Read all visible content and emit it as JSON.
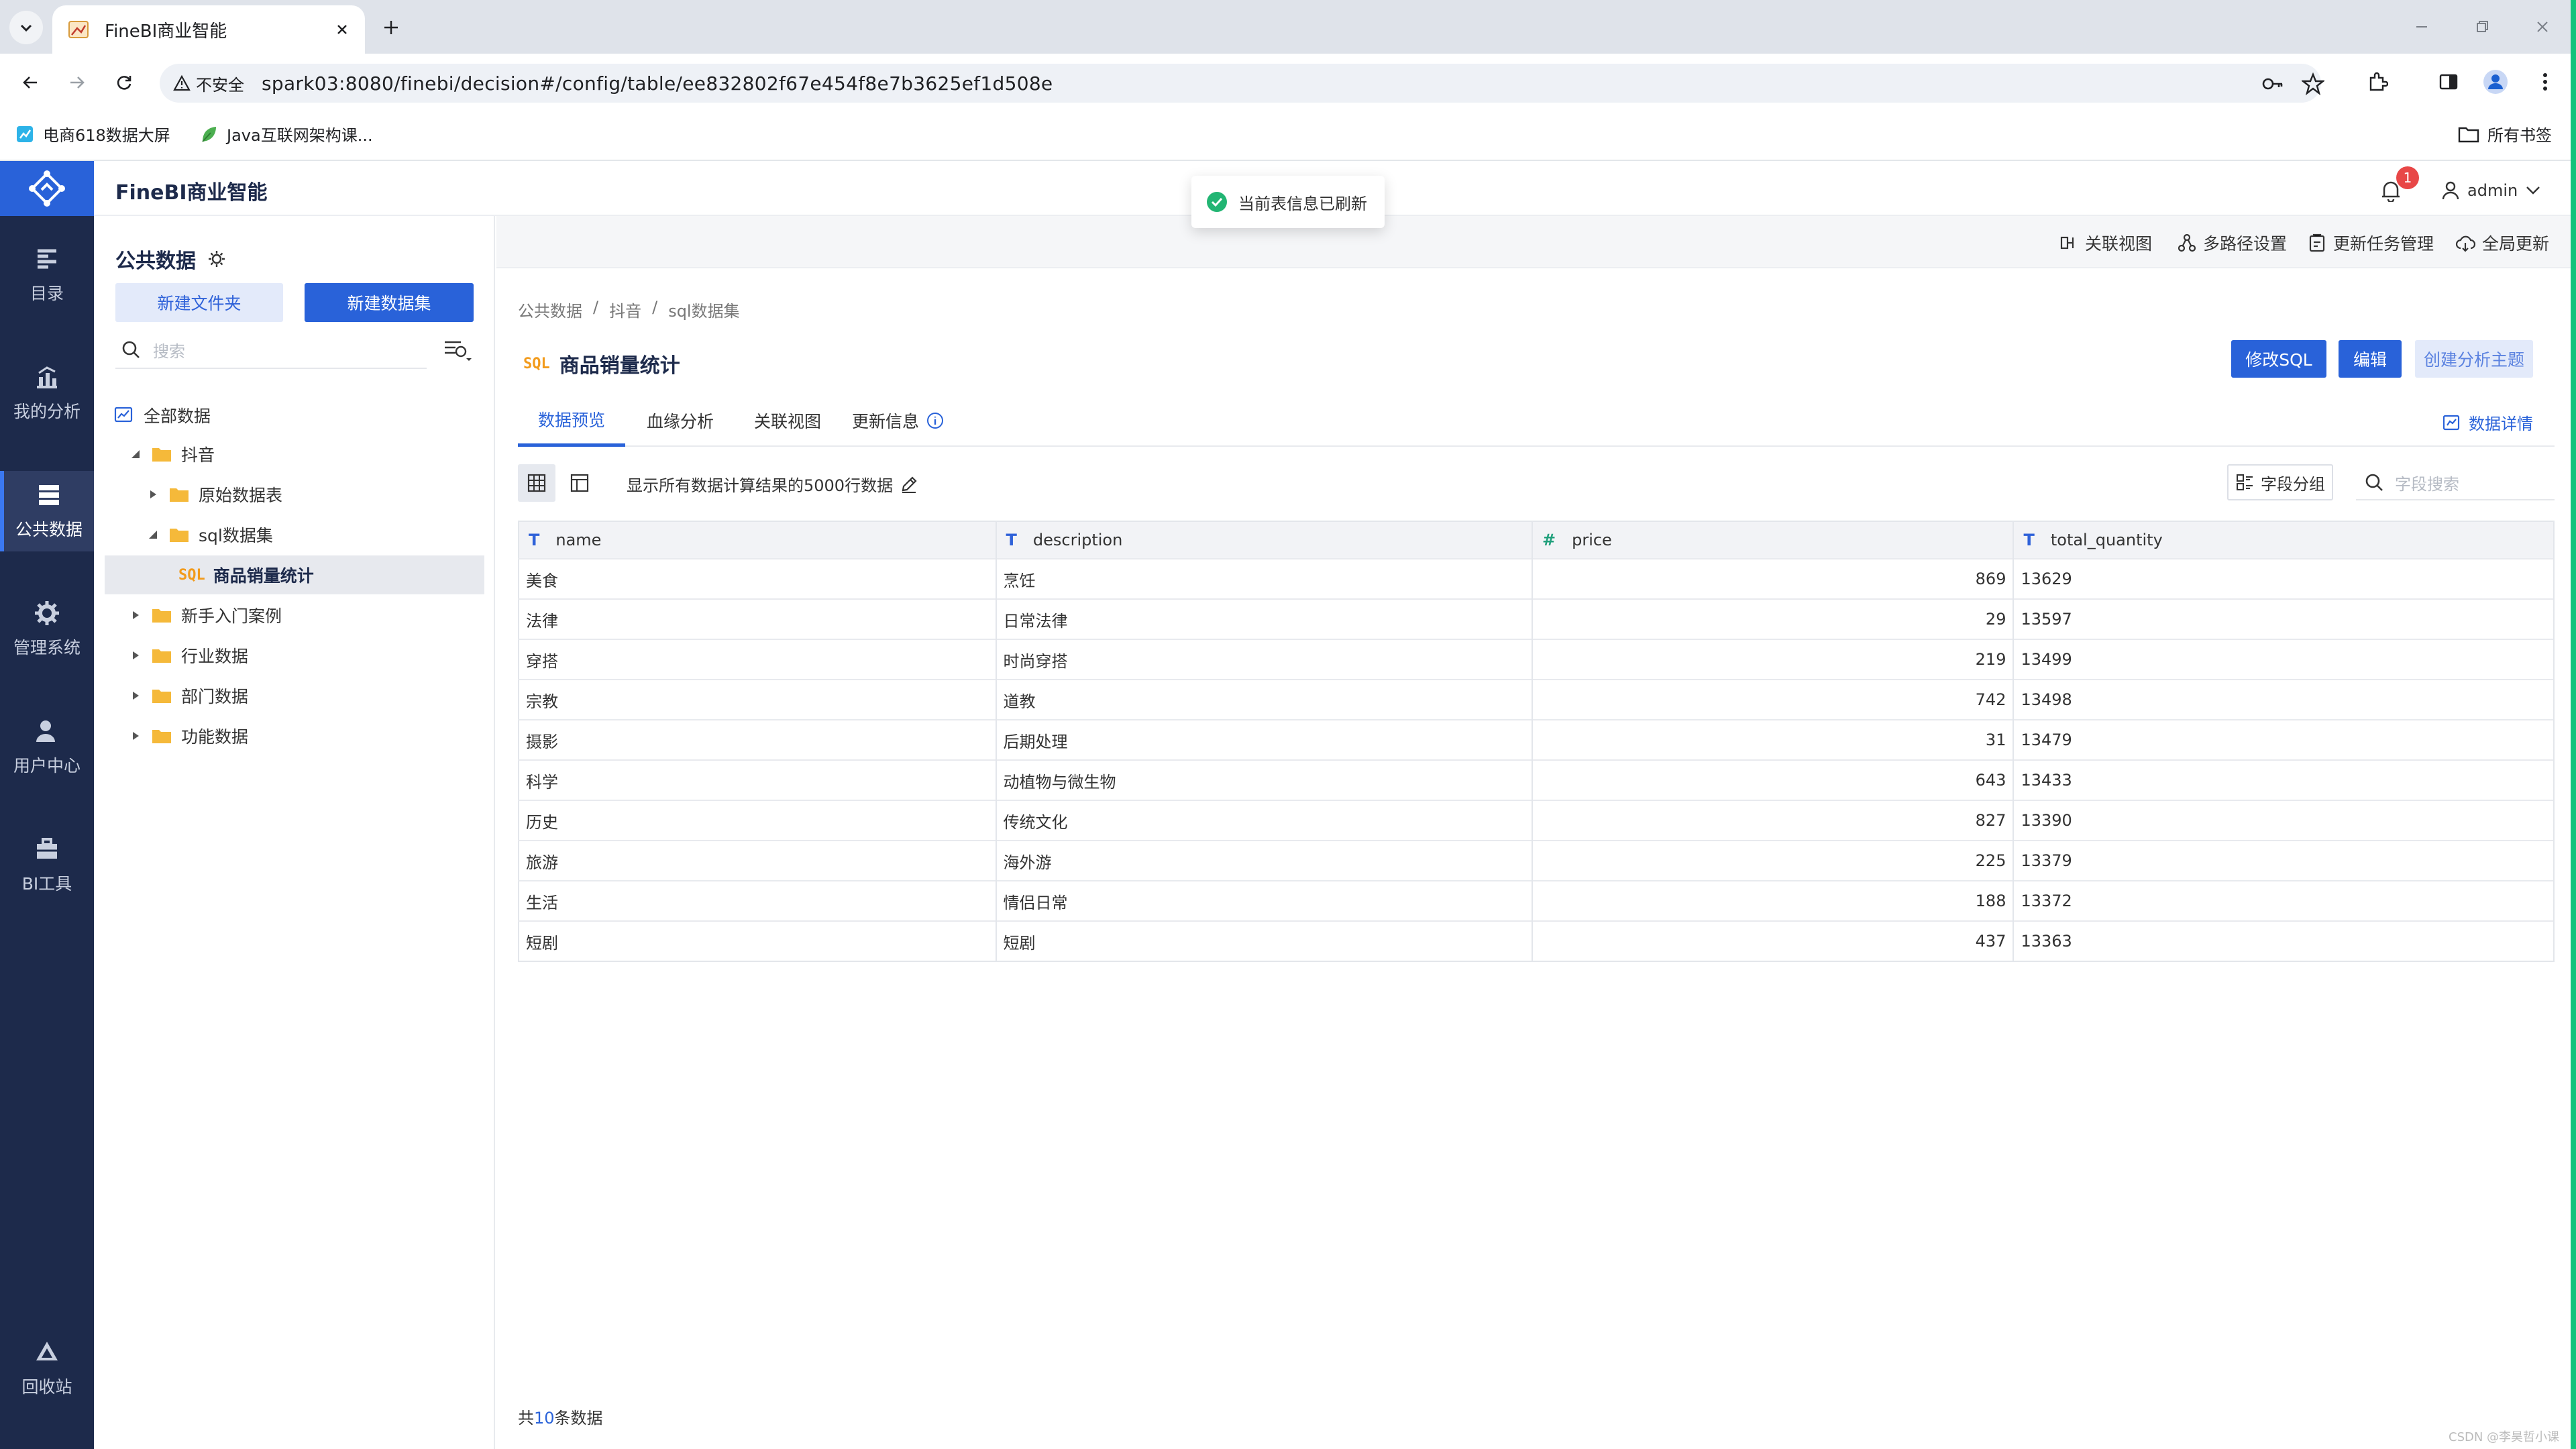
{
  "browser": {
    "tab_title": "FineBI商业智能",
    "security_label": "不安全",
    "url": "spark03:8080/finebi/decision#/config/table/ee832802f67e454f8e7b3625ef1d508e",
    "bookmarks": [
      {
        "label": "电商618数据大屏",
        "icon": "chart-bookmark-icon"
      },
      {
        "label": "Java互联网架构课...",
        "icon": "leaf-bookmark-icon"
      }
    ],
    "all_bookmarks": "所有书签"
  },
  "app": {
    "title": "FineBI商业智能",
    "notification_count": "1",
    "user": "admin",
    "toast": "当前表信息已刷新"
  },
  "rail": [
    {
      "label": "目录",
      "icon": "catalog-icon"
    },
    {
      "label": "我的分析",
      "icon": "analysis-icon"
    },
    {
      "label": "公共数据",
      "icon": "public-data-icon",
      "active": true
    },
    {
      "label": "管理系统",
      "icon": "gear-icon"
    },
    {
      "label": "用户中心",
      "icon": "user-icon"
    },
    {
      "label": "BI工具",
      "icon": "toolbox-icon"
    },
    {
      "label": "回收站",
      "icon": "recycle-icon"
    }
  ],
  "left_panel": {
    "title": "公共数据",
    "new_folder": "新建文件夹",
    "new_dataset": "新建数据集",
    "search_placeholder": "搜索",
    "tree": [
      {
        "label": "全部数据",
        "level": 0,
        "type": "root"
      },
      {
        "label": "抖音",
        "level": 1,
        "type": "folder",
        "expanded": true
      },
      {
        "label": "原始数据表",
        "level": 2,
        "type": "folder",
        "expanded": false
      },
      {
        "label": "sql数据集",
        "level": 2,
        "type": "folder",
        "expanded": true
      },
      {
        "label": "商品销量统计",
        "level": 3,
        "type": "sql",
        "selected": true
      },
      {
        "label": "新手入门案例",
        "level": 1,
        "type": "folder",
        "expanded": false
      },
      {
        "label": "行业数据",
        "level": 1,
        "type": "folder",
        "expanded": false
      },
      {
        "label": "部门数据",
        "level": 1,
        "type": "folder",
        "expanded": false
      },
      {
        "label": "功能数据",
        "level": 1,
        "type": "folder",
        "expanded": false
      }
    ]
  },
  "main": {
    "top_actions": [
      "关联视图",
      "多路径设置",
      "更新任务管理",
      "全局更新"
    ],
    "breadcrumb": [
      "公共数据",
      "/",
      "抖音",
      "/",
      "sql数据集"
    ],
    "sql_badge": "SQL",
    "dataset_title": "商品销量统计",
    "buttons": {
      "edit_sql": "修改SQL",
      "edit": "编辑",
      "create_topic": "创建分析主题"
    },
    "tabs": [
      "数据预览",
      "血缘分析",
      "关联视图",
      "更新信息"
    ],
    "data_detail": "数据详情",
    "row_note": "显示所有数据计算结果的5000行数据",
    "field_group": "字段分组",
    "field_search_placeholder": "字段搜索",
    "table": {
      "columns": [
        {
          "name": "name",
          "type": "T"
        },
        {
          "name": "description",
          "type": "T"
        },
        {
          "name": "price",
          "type": "#"
        },
        {
          "name": "total_quantity",
          "type": "T"
        }
      ],
      "rows": [
        [
          "美食",
          "烹饪",
          "869",
          "13629"
        ],
        [
          "法律",
          "日常法律",
          "29",
          "13597"
        ],
        [
          "穿搭",
          "时尚穿搭",
          "219",
          "13499"
        ],
        [
          "宗教",
          "道教",
          "742",
          "13498"
        ],
        [
          "摄影",
          "后期处理",
          "31",
          "13479"
        ],
        [
          "科学",
          "动植物与微生物",
          "643",
          "13433"
        ],
        [
          "历史",
          "传统文化",
          "827",
          "13390"
        ],
        [
          "旅游",
          "海外游",
          "225",
          "13379"
        ],
        [
          "生活",
          "情侣日常",
          "188",
          "13372"
        ],
        [
          "短剧",
          "短剧",
          "437",
          "13363"
        ]
      ]
    },
    "footer": {
      "prefix": "共",
      "count": "10",
      "suffix": "条数据"
    }
  },
  "watermark": "CSDN @李昊哲小课"
}
